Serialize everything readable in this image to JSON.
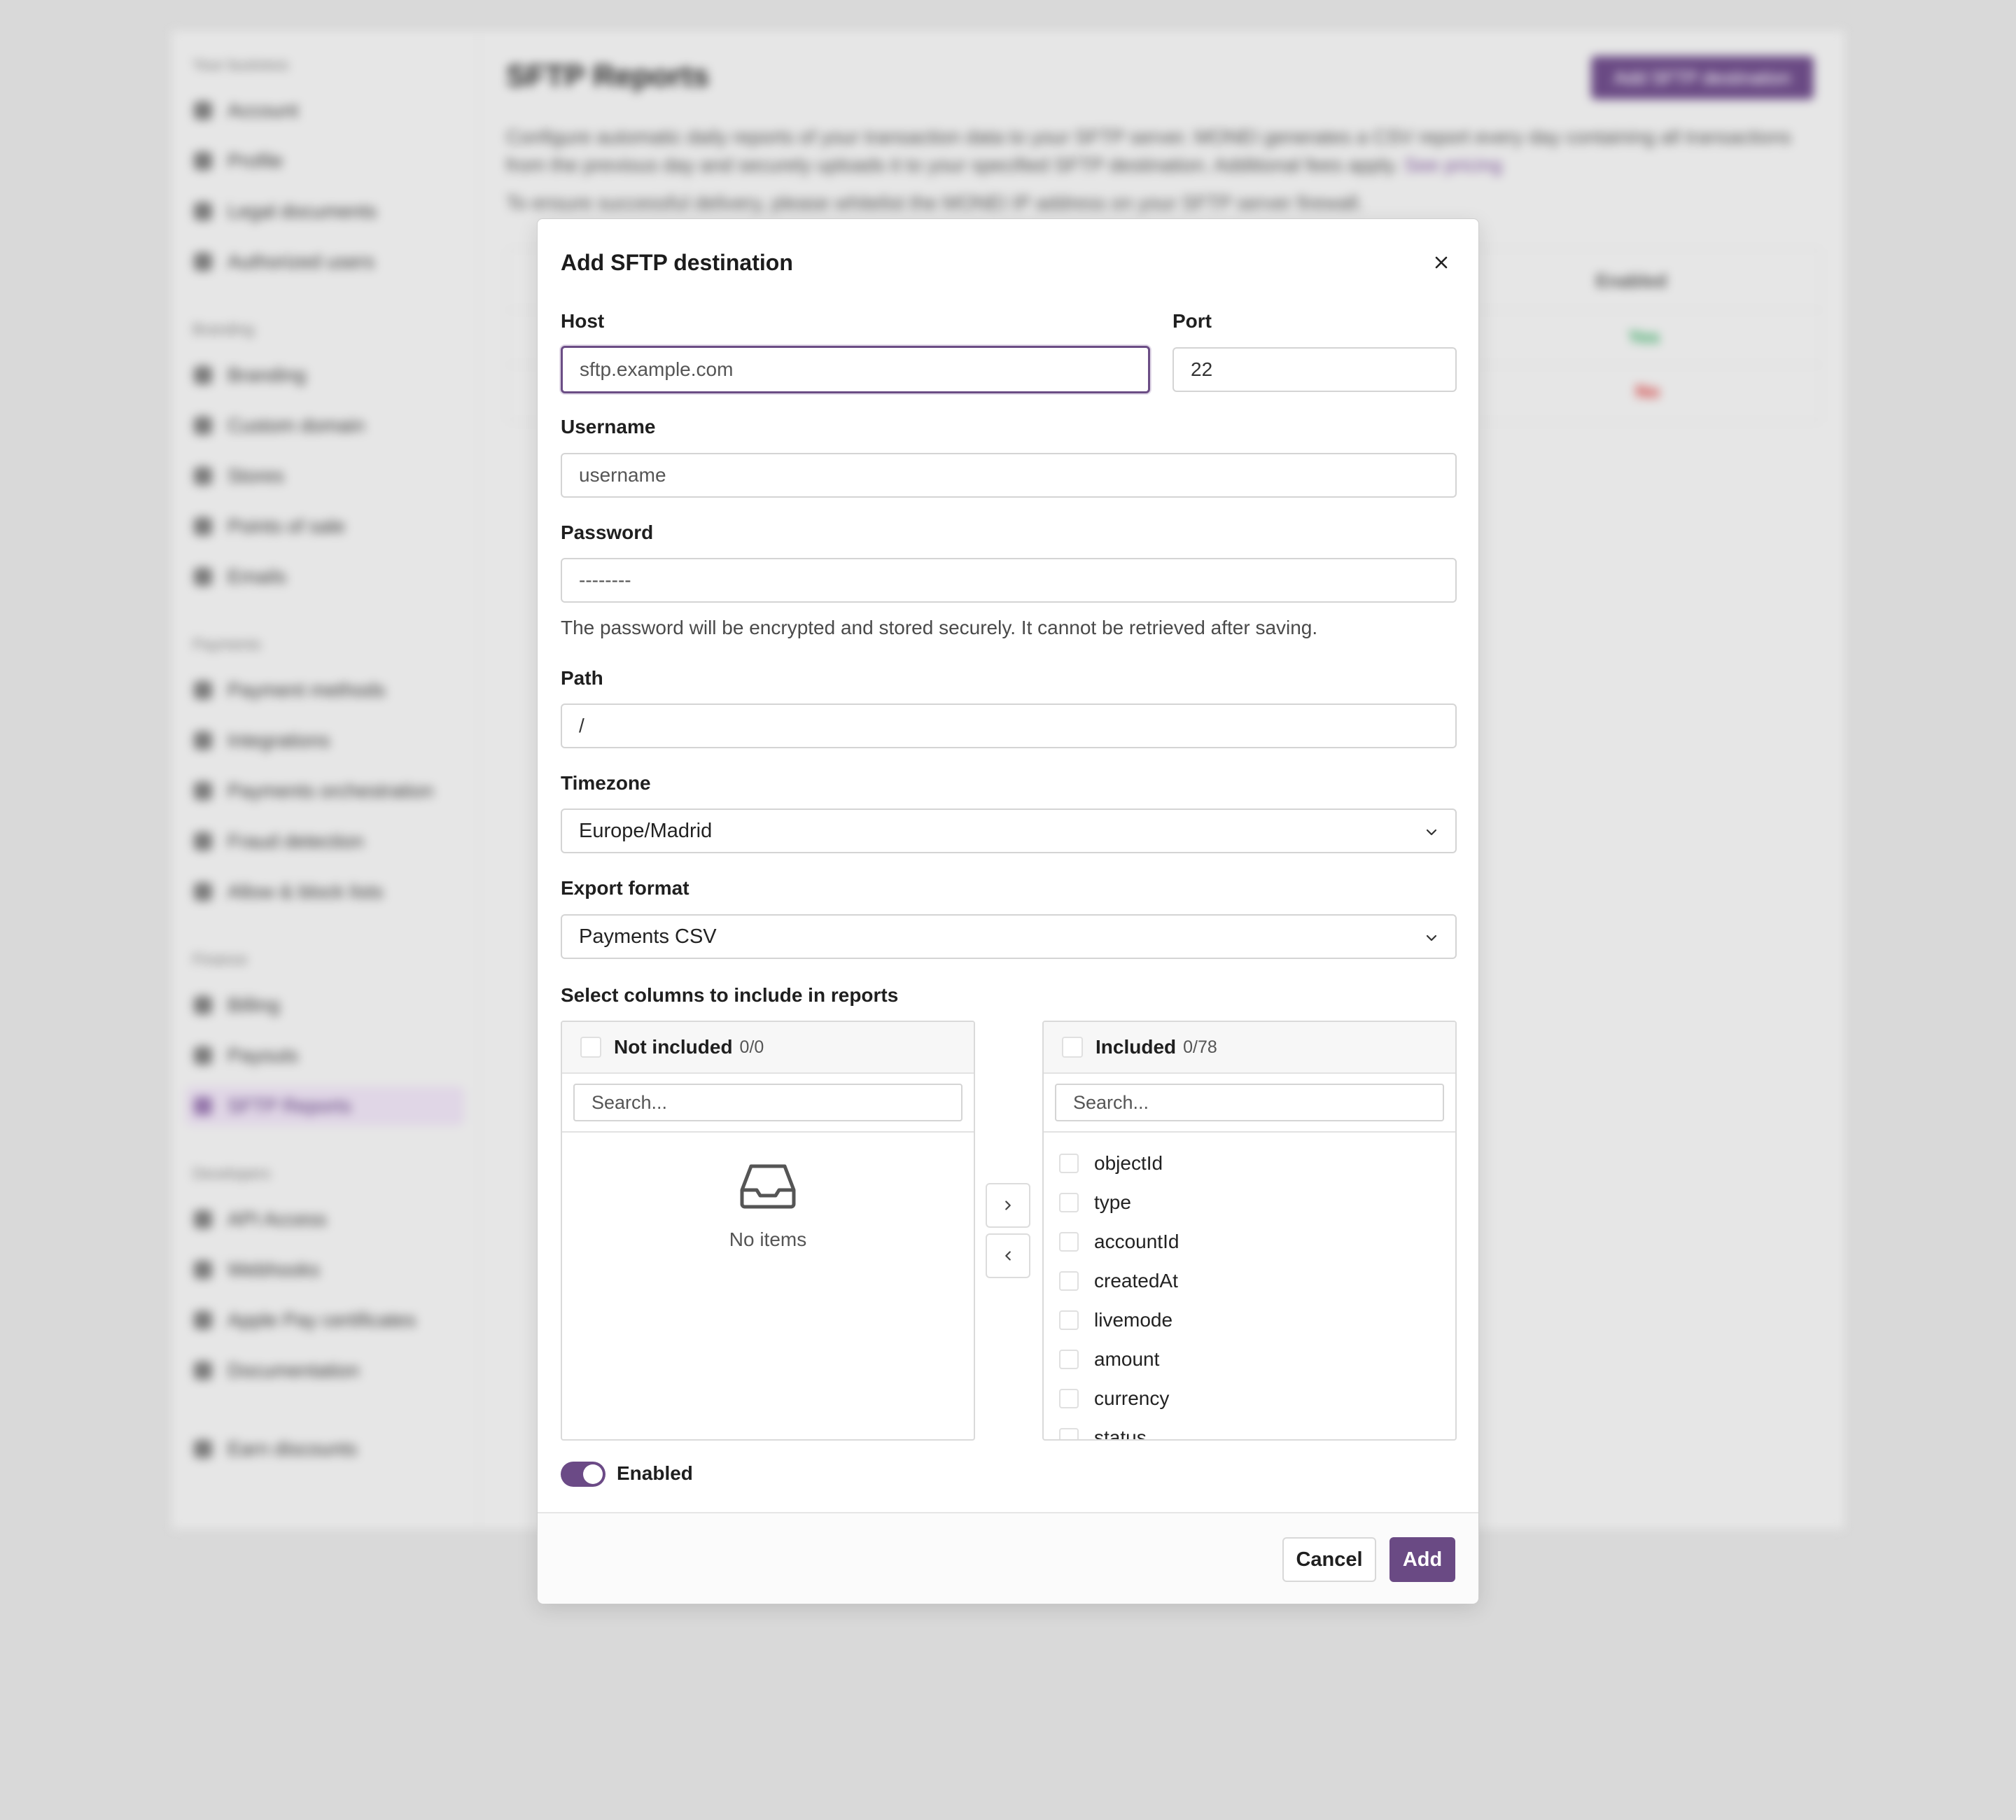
{
  "background": {
    "sidebar": {
      "sections": [
        {
          "title": "Your business",
          "items": [
            "Account",
            "Profile",
            "Legal documents",
            "Authorized users"
          ]
        },
        {
          "title": "Branding",
          "items": [
            "Branding",
            "Custom domain",
            "Stores",
            "Points of sale",
            "Emails"
          ]
        },
        {
          "title": "Payments",
          "items": [
            "Payment methods",
            "Integrations",
            "Payments orchestration",
            "Fraud detection",
            "Allow & block lists"
          ]
        },
        {
          "title": "Finance",
          "items": [
            "Billing",
            "Payouts",
            "SFTP Reports"
          ]
        },
        {
          "title": "Developers",
          "items": [
            "API Access",
            "Webhooks",
            "Apple Pay certificates",
            "Documentation"
          ]
        }
      ],
      "bottom_item": "Earn discounts",
      "active_item": "SFTP Reports"
    },
    "title": "SFTP Reports",
    "add_button": "Add SFTP destination",
    "description": "Configure automatic daily reports of your transaction data to your SFTP server. MONEI generates a CSV report every day containing all transactions from the previous day and securely uploads it to your specified SFTP destination. Additional fees apply.",
    "description_link": "See pricing",
    "whitelist_text": "To ensure successful delivery, please whitelist the MONEI IP address",
    "whitelist_suffix": "on your SFTP server firewall.",
    "table_header_enabled": "Enabled",
    "rows": [
      {
        "status": "Yes"
      },
      {
        "status": "No"
      }
    ]
  },
  "modal": {
    "title": "Add SFTP destination",
    "host": {
      "label": "Host",
      "placeholder": "sftp.example.com"
    },
    "port": {
      "label": "Port",
      "value": "22"
    },
    "username": {
      "label": "Username",
      "placeholder": "username"
    },
    "password": {
      "label": "Password",
      "placeholder": "--------",
      "hint": "The password will be encrypted and stored securely. It cannot be retrieved after saving."
    },
    "path": {
      "label": "Path",
      "value": "/"
    },
    "timezone": {
      "label": "Timezone",
      "value": "Europe/Madrid"
    },
    "export_format": {
      "label": "Export format",
      "value": "Payments CSV"
    },
    "columns": {
      "label": "Select columns to include in reports",
      "not_included": {
        "title": "Not included",
        "count": "0/0",
        "search_placeholder": "Search...",
        "empty_text": "No items"
      },
      "included": {
        "title": "Included",
        "count": "0/78",
        "search_placeholder": "Search...",
        "items": [
          "objectId",
          "type",
          "accountId",
          "createdAt",
          "livemode",
          "amount",
          "currency",
          "status"
        ]
      }
    },
    "enabled_label": "Enabled",
    "enabled": true,
    "cancel": "Cancel",
    "add": "Add"
  },
  "colors": {
    "accent": "#6a4a84",
    "yes": "#2fa35b",
    "no": "#d03a3a"
  }
}
